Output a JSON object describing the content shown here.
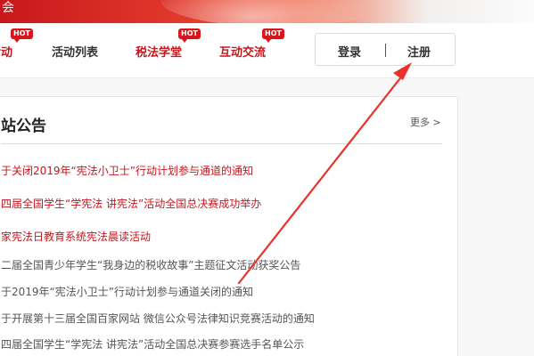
{
  "banner": {
    "logo_fragment": "会"
  },
  "nav": {
    "items": [
      {
        "label": "活动",
        "hot": "HOT"
      },
      {
        "label": "活动列表"
      },
      {
        "label": "税法学堂",
        "hot": "HOT"
      },
      {
        "label": "互动交流",
        "hot": "HOT"
      }
    ],
    "login_label": "登录",
    "register_label": "注册"
  },
  "panel": {
    "title": "站公告",
    "more_label": "更多 >",
    "notices": [
      {
        "text": "于关闭2019年“宪法小卫士”行动计划参与通道的通知",
        "color": "#c5161d"
      },
      {
        "text": "四届全国学生“学宪法 讲宪法”活动全国总决赛成功举办",
        "color": "#c5161d"
      },
      {
        "text": "家宪法日教育系统宪法晨读活动",
        "color": "#c5161d"
      },
      {
        "text": "二届全国青少年学生“我身边的税收故事”主题征文活动获奖公告",
        "color": "#555555"
      },
      {
        "text": "于2019年“宪法小卫士”行动计划参与通道关闭的通知",
        "color": "#555555"
      },
      {
        "text": "于开展第十三届全国百家网站 微信公众号法律知识竞赛活动的通知",
        "color": "#555555"
      },
      {
        "text": "四届全国学生“学宪法 讲宪法”活动全国总决赛参赛选手名单公示",
        "color": "#555555"
      }
    ]
  },
  "colors": {
    "brand_red": "#c5161d",
    "arrow_red": "#e8322b"
  }
}
